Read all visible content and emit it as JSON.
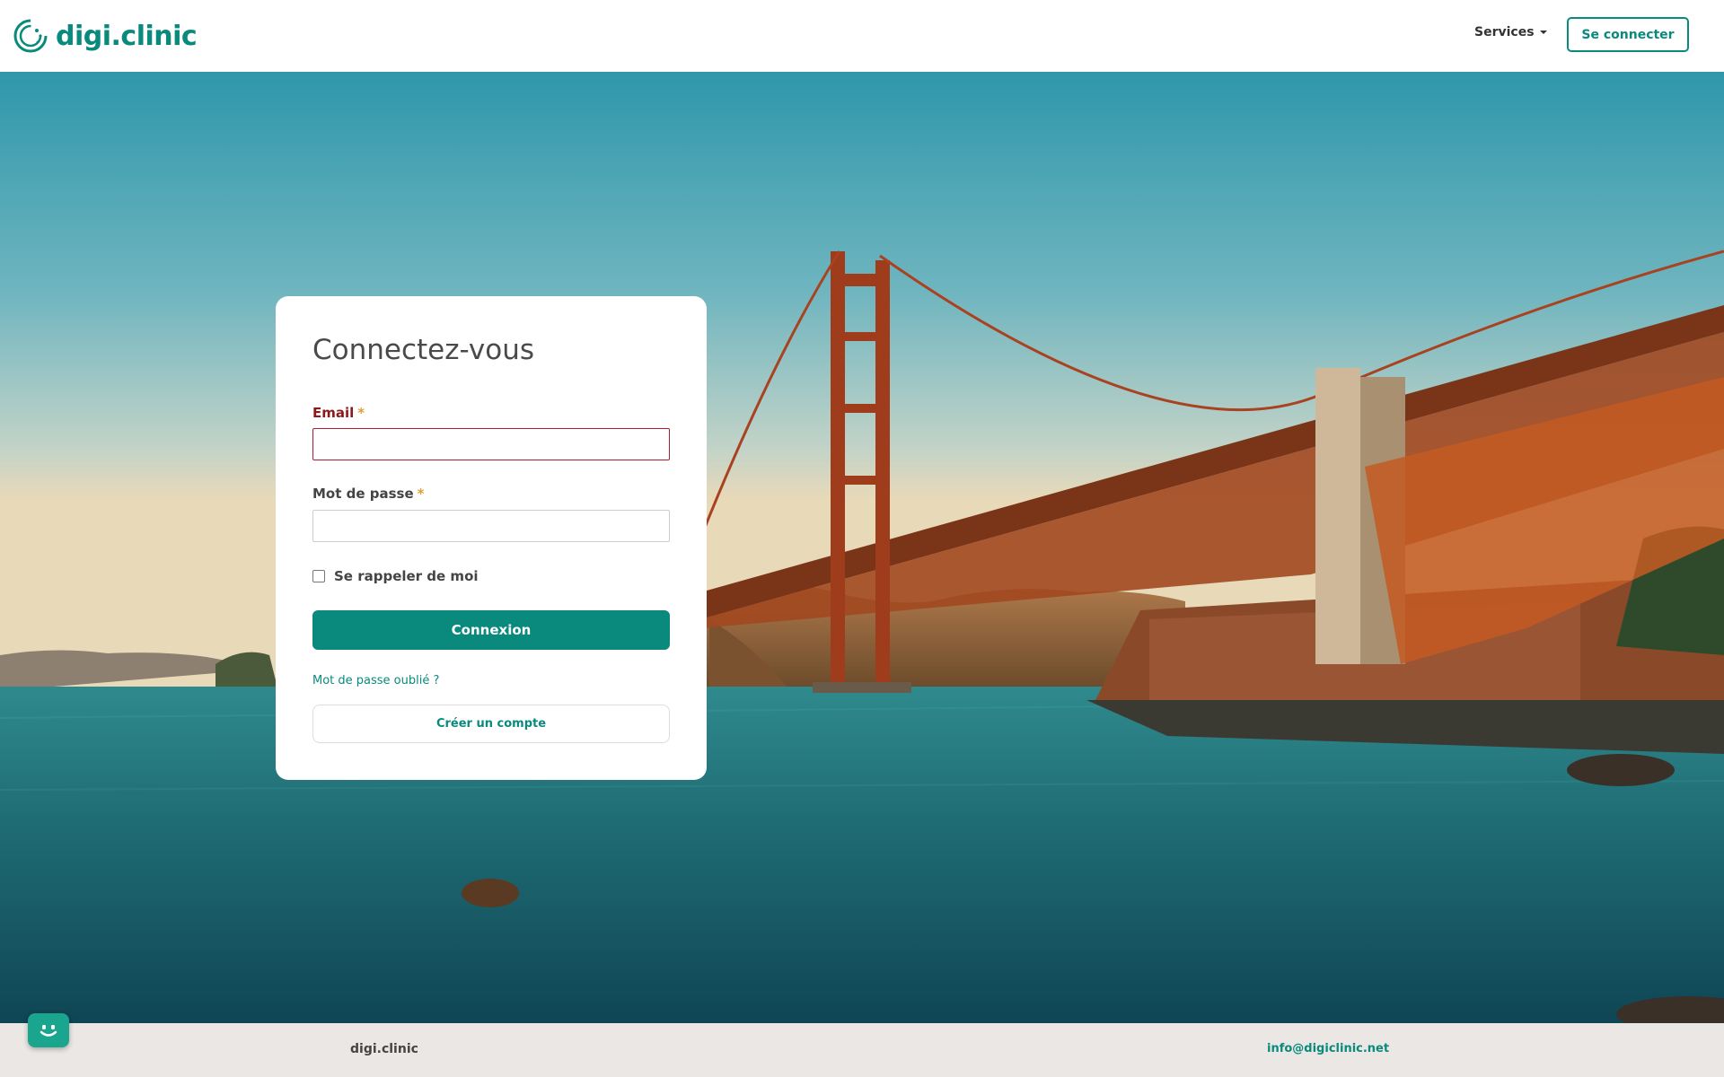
{
  "header": {
    "logo_text": "digi.clinic",
    "nav_services": "Services",
    "login_button": "Se connecter"
  },
  "login": {
    "title": "Connectez-vous",
    "email_label": "Email",
    "password_label": "Mot de passe",
    "required_marker": "*",
    "email_value": "",
    "password_value": "",
    "remember_label": "Se rappeler de moi",
    "remember_checked": false,
    "submit_label": "Connexion",
    "forgot_link": "Mot de passe oublié ?",
    "create_account": "Créer un compte"
  },
  "footer": {
    "brand": "digi.clinic",
    "email": "info@digiclinic.net"
  },
  "colors": {
    "brand": "#0a8a7c",
    "error": "#b01c2e",
    "required": "#e0a030",
    "footer_bg": "#ebe7e4",
    "bridge": "#b8461e"
  },
  "icons": {
    "logo": "circle-logo-icon",
    "services_dropdown": "caret-down-icon",
    "chat": "smiley-chat-icon"
  }
}
